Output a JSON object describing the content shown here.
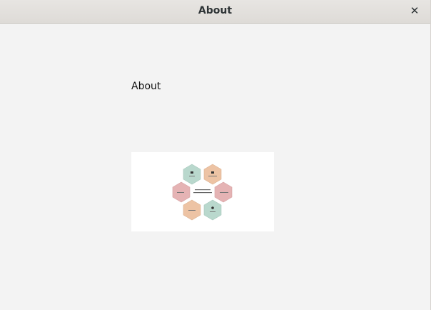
{
  "window": {
    "title": "About"
  },
  "titlebar": {
    "close_icon": "close-icon"
  },
  "content": {
    "heading": "About",
    "image": {
      "description_icon": "diagram-image"
    }
  },
  "colors": {
    "teal": "#b9d8cd",
    "peach": "#edc3a4",
    "rose": "#e5b3b4"
  }
}
